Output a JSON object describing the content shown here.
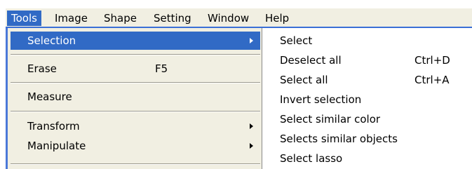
{
  "menubar": {
    "items": [
      {
        "label": "Tools",
        "active": true
      },
      {
        "label": "Image"
      },
      {
        "label": "Shape"
      },
      {
        "label": "Setting"
      },
      {
        "label": "Window"
      },
      {
        "label": "Help"
      }
    ]
  },
  "tools_menu": {
    "items": [
      {
        "label": "Selection",
        "has_submenu": true,
        "active": true
      },
      {
        "label": "Erase",
        "shortcut": "F5"
      },
      {
        "label": "Measure"
      },
      {
        "label": "Transform",
        "has_submenu": true
      },
      {
        "label": "Manipulate",
        "has_submenu": true
      }
    ]
  },
  "selection_submenu": {
    "items": [
      {
        "label": "Select"
      },
      {
        "label": "Deselect all",
        "shortcut": "Ctrl+D"
      },
      {
        "label": "Select all",
        "shortcut": "Ctrl+A"
      },
      {
        "label": "Invert selection"
      },
      {
        "label": "Select similar color"
      },
      {
        "label": "Selects similar objects"
      },
      {
        "label": "Select lasso"
      }
    ]
  },
  "colors": {
    "highlight": "#316ac5",
    "menubar_background": "#f1efe2",
    "menubar_underline": "#3a6fd6"
  }
}
